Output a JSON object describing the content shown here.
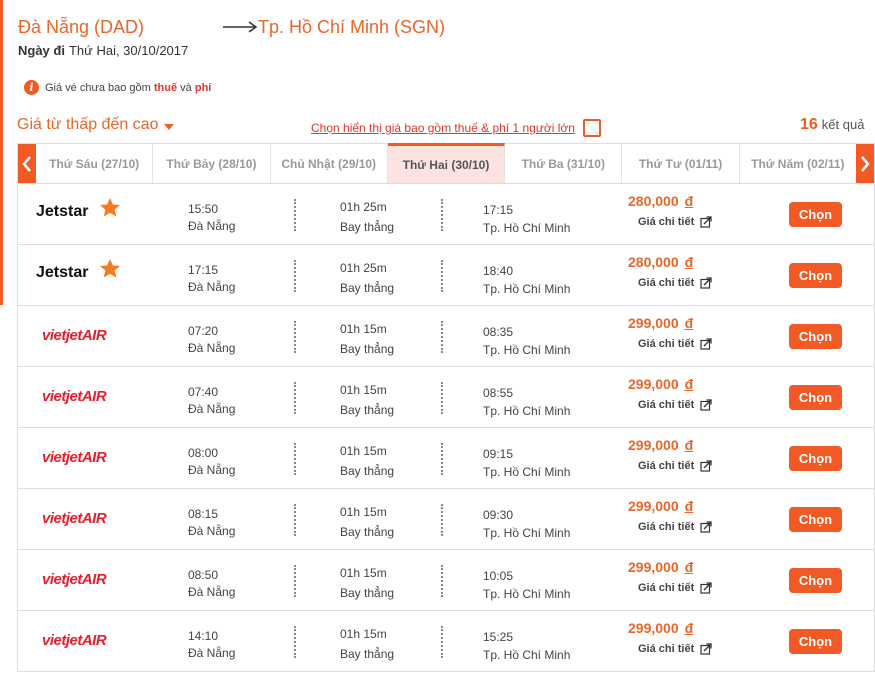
{
  "route": {
    "origin": "Đà Nẵng (DAD)",
    "destination": "Tp. Hồ Chí Minh (SGN)",
    "date_label": "Ngày đi",
    "date_value": "Thứ Hai, 30/10/2017"
  },
  "notice": {
    "prefix": "Giá vé chưa bao gồm",
    "tax": "thuế",
    "and": "và",
    "fee": "phí"
  },
  "sortbar": {
    "sort_label": "Giá từ thấp đến cao",
    "tax_toggle_label": "Chọn hiển thị giá bao gồm thuế & phí 1 người lớn",
    "tax_toggle_checked": false,
    "result_count": "16",
    "result_suffix": "kết quả"
  },
  "date_tabs": [
    {
      "label": "Thứ Sáu (27/10)",
      "active": false
    },
    {
      "label": "Thứ Bảy (28/10)",
      "active": false
    },
    {
      "label": "Chủ Nhật (29/10)",
      "active": false
    },
    {
      "label": "Thứ Hai (30/10)",
      "active": true
    },
    {
      "label": "Thứ Ba (31/10)",
      "active": false
    },
    {
      "label": "Thứ Tư (01/11)",
      "active": false
    },
    {
      "label": "Thứ Năm (02/11)",
      "active": false
    }
  ],
  "flights": [
    {
      "airline": "Jetstar",
      "dep_time": "15:50",
      "dep_city": "Đà Nẵng",
      "duration": "01h 25m",
      "type": "Bay thẳng",
      "arr_time": "17:15",
      "arr_city": "Tp. Hồ Chí Minh",
      "price": "280,000",
      "currency": "đ",
      "detail": "Giá chi tiết",
      "action": "Chọn"
    },
    {
      "airline": "Jetstar",
      "dep_time": "17:15",
      "dep_city": "Đà Nẵng",
      "duration": "01h 25m",
      "type": "Bay thẳng",
      "arr_time": "18:40",
      "arr_city": "Tp. Hồ Chí Minh",
      "price": "280,000",
      "currency": "đ",
      "detail": "Giá chi tiết",
      "action": "Chọn"
    },
    {
      "airline": "VietJet Air",
      "dep_time": "07:20",
      "dep_city": "Đà Nẵng",
      "duration": "01h 15m",
      "type": "Bay thẳng",
      "arr_time": "08:35",
      "arr_city": "Tp. Hồ Chí Minh",
      "price": "299,000",
      "currency": "đ",
      "detail": "Giá chi tiết",
      "action": "Chọn"
    },
    {
      "airline": "VietJet Air",
      "dep_time": "07:40",
      "dep_city": "Đà Nẵng",
      "duration": "01h 15m",
      "type": "Bay thẳng",
      "arr_time": "08:55",
      "arr_city": "Tp. Hồ Chí Minh",
      "price": "299,000",
      "currency": "đ",
      "detail": "Giá chi tiết",
      "action": "Chọn"
    },
    {
      "airline": "VietJet Air",
      "dep_time": "08:00",
      "dep_city": "Đà Nẵng",
      "duration": "01h 15m",
      "type": "Bay thẳng",
      "arr_time": "09:15",
      "arr_city": "Tp. Hồ Chí Minh",
      "price": "299,000",
      "currency": "đ",
      "detail": "Giá chi tiết",
      "action": "Chọn"
    },
    {
      "airline": "VietJet Air",
      "dep_time": "08:15",
      "dep_city": "Đà Nẵng",
      "duration": "01h 15m",
      "type": "Bay thẳng",
      "arr_time": "09:30",
      "arr_city": "Tp. Hồ Chí Minh",
      "price": "299,000",
      "currency": "đ",
      "detail": "Giá chi tiết",
      "action": "Chọn"
    },
    {
      "airline": "VietJet Air",
      "dep_time": "08:50",
      "dep_city": "Đà Nẵng",
      "duration": "01h 15m",
      "type": "Bay thẳng",
      "arr_time": "10:05",
      "arr_city": "Tp. Hồ Chí Minh",
      "price": "299,000",
      "currency": "đ",
      "detail": "Giá chi tiết",
      "action": "Chọn"
    },
    {
      "airline": "VietJet Air",
      "dep_time": "14:10",
      "dep_city": "Đà Nẵng",
      "duration": "01h 15m",
      "type": "Bay thẳng",
      "arr_time": "15:25",
      "arr_city": "Tp. Hồ Chí Minh",
      "price": "299,000",
      "currency": "đ",
      "detail": "Giá chi tiết",
      "action": "Chọn"
    }
  ],
  "colors": {
    "accent": "#f15a24",
    "price": "#e8662a",
    "highlight": "#e4332b",
    "active_tab_bg": "#fde3df",
    "jetstar_star": "#f47b20",
    "vietjet_red": "#e4202e"
  },
  "icons": {
    "info": "info-icon",
    "arrow": "arrow-right-icon",
    "prev": "chevron-left-icon",
    "next": "chevron-right-icon",
    "detail": "external-link-icon"
  },
  "airline_logo_text": {
    "Jetstar": "Jetstar",
    "VietJet Air": "vietjetAIR"
  }
}
